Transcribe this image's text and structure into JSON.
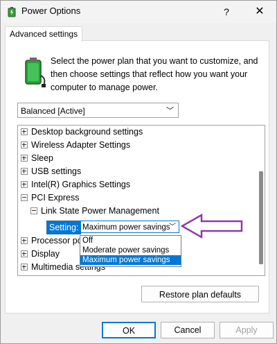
{
  "window": {
    "title": "Power Options",
    "help": "?",
    "close": "✕"
  },
  "tab": {
    "label": "Advanced settings"
  },
  "description": "Select the power plan that you want to customize, and then choose settings that reflect how you want your computer to manage power.",
  "plan_select": {
    "value": "Balanced [Active]"
  },
  "tree": {
    "items": [
      {
        "label": "Desktop background settings",
        "expanded": false
      },
      {
        "label": "Wireless Adapter Settings",
        "expanded": false
      },
      {
        "label": "Sleep",
        "expanded": false
      },
      {
        "label": "USB settings",
        "expanded": false
      },
      {
        "label": "Intel(R) Graphics Settings",
        "expanded": false
      },
      {
        "label": "PCI Express",
        "expanded": true
      },
      {
        "label": "Link State Power Management",
        "expanded": true
      },
      {
        "label": "Processor po",
        "expanded": false
      },
      {
        "label": "Display",
        "expanded": false
      },
      {
        "label": "Multimedia settings",
        "expanded": false
      }
    ],
    "setting_label": "Setting:",
    "setting_value": "Maximum power savings"
  },
  "dropdown": {
    "options": [
      "Off",
      "Moderate power savings",
      "Maximum power savings"
    ],
    "selected_index": 2
  },
  "buttons": {
    "restore": "Restore plan defaults",
    "ok": "OK",
    "cancel": "Cancel",
    "apply": "Apply"
  },
  "colors": {
    "accent": "#0078d7",
    "arrow": "#8e3aa8"
  }
}
